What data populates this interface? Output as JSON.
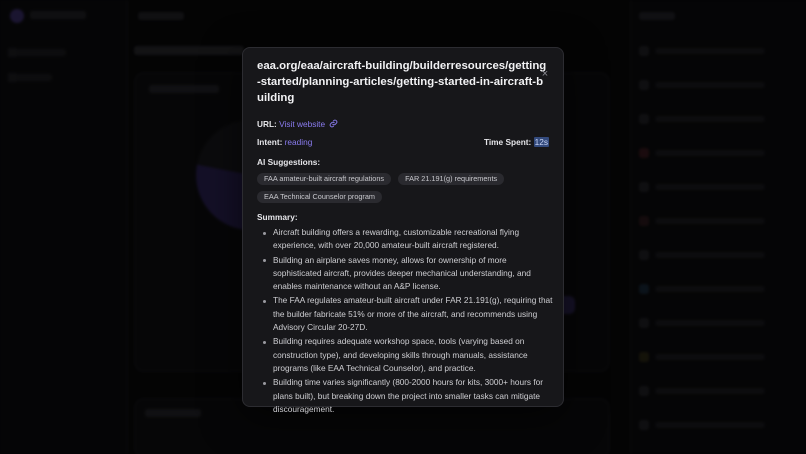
{
  "modal": {
    "title": "eaa.org/eaa/aircraft-building/builderresources/getting-started/planning-articles/getting-started-in-aircraft-building",
    "close_icon": "×",
    "url_label": "URL:",
    "url_link_text": "Visit website",
    "intent_label": "Intent:",
    "intent_value": "reading",
    "time_label": "Time Spent:",
    "time_value": "12s",
    "ai_suggestions_label": "AI Suggestions:",
    "suggestions": [
      "FAA amateur-built aircraft regulations",
      "FAR 21.191(g) requirements",
      "EAA Technical Counselor program"
    ],
    "summary_label": "Summary:",
    "summary": [
      "Aircraft building offers a rewarding, customizable recreational flying experience, with over 20,000 amateur-built aircraft registered.",
      "Building an airplane saves money, allows for ownership of more sophisticated aircraft, provides deeper mechanical understanding, and enables maintenance without an A&P license.",
      "The FAA regulates amateur-built aircraft under FAR 21.191(g), requiring that the builder fabricate 51% or more of the aircraft, and recommends using Advisory Circular 20-27D.",
      "Building requires adequate workshop space, tools (varying based on construction type), and developing skills through manuals, assistance programs (like EAA Technical Counselor), and practice.",
      "Building time varies significantly (800-2000 hours for kits, 3000+ hours for plans built), but breaking down the project into smaller tasks can mitigate discouragement."
    ]
  },
  "colors": {
    "accent": "#8a7cf0",
    "modal_bg": "#17171a",
    "chip_bg": "#2a2a2f",
    "highlight": "#334a7d"
  },
  "icons": {
    "close": "close-icon",
    "link": "external-link-icon"
  }
}
